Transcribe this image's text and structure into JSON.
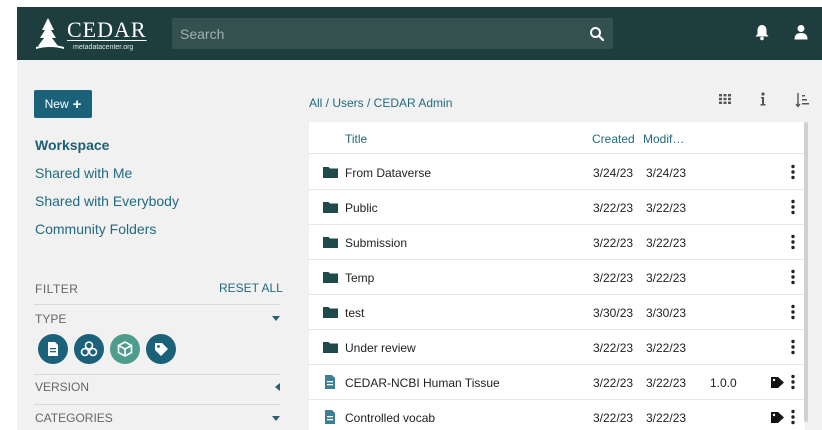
{
  "header": {
    "logo_title": "CEDAR",
    "logo_subtitle": "metadatacenter.org",
    "search_placeholder": "Search"
  },
  "sidebar": {
    "new_label": "New",
    "nav": [
      {
        "label": "Workspace",
        "active": true
      },
      {
        "label": "Shared with Me",
        "active": false
      },
      {
        "label": "Shared with Everybody",
        "active": false
      },
      {
        "label": "Community Folders",
        "active": false
      }
    ],
    "filter": {
      "label": "FILTER",
      "reset_all": "RESET ALL",
      "type_label": "TYPE",
      "type_icons": [
        {
          "name": "field-type-icon",
          "color": "#1b6179"
        },
        {
          "name": "element-type-icon",
          "color": "#1b6179"
        },
        {
          "name": "template-type-icon",
          "color": "#4f9c8d"
        },
        {
          "name": "instance-type-icon",
          "color": "#1b6179"
        }
      ],
      "version_label": "VERSION",
      "categories_label": "CATEGORIES"
    }
  },
  "main": {
    "breadcrumb": "All / Users / CEDAR Admin",
    "columns": {
      "title": "Title",
      "created": "Created",
      "modified": "Modif…"
    },
    "rows": [
      {
        "type": "folder",
        "name": "From Dataverse",
        "created": "3/24/23",
        "modified": "3/24/23",
        "version": "",
        "tagged": false
      },
      {
        "type": "folder",
        "name": "Public",
        "created": "3/22/23",
        "modified": "3/22/23",
        "version": "",
        "tagged": false
      },
      {
        "type": "folder",
        "name": "Submission",
        "created": "3/22/23",
        "modified": "3/22/23",
        "version": "",
        "tagged": false
      },
      {
        "type": "folder",
        "name": "Temp",
        "created": "3/22/23",
        "modified": "3/22/23",
        "version": "",
        "tagged": false
      },
      {
        "type": "folder",
        "name": "test",
        "created": "3/30/23",
        "modified": "3/30/23",
        "version": "",
        "tagged": false
      },
      {
        "type": "folder",
        "name": "Under review",
        "created": "3/22/23",
        "modified": "3/22/23",
        "version": "",
        "tagged": false
      },
      {
        "type": "template",
        "name": "CEDAR-NCBI Human Tissue",
        "created": "3/22/23",
        "modified": "3/22/23",
        "version": "1.0.0",
        "tagged": true
      },
      {
        "type": "template",
        "name": "Controlled vocab",
        "created": "3/22/23",
        "modified": "3/22/23",
        "version": "",
        "tagged": true
      }
    ]
  },
  "colors": {
    "header_bg": "#1d3d3e",
    "accent": "#1b6179",
    "link": "#226a80",
    "panel_bg": "#f1f1f1"
  }
}
